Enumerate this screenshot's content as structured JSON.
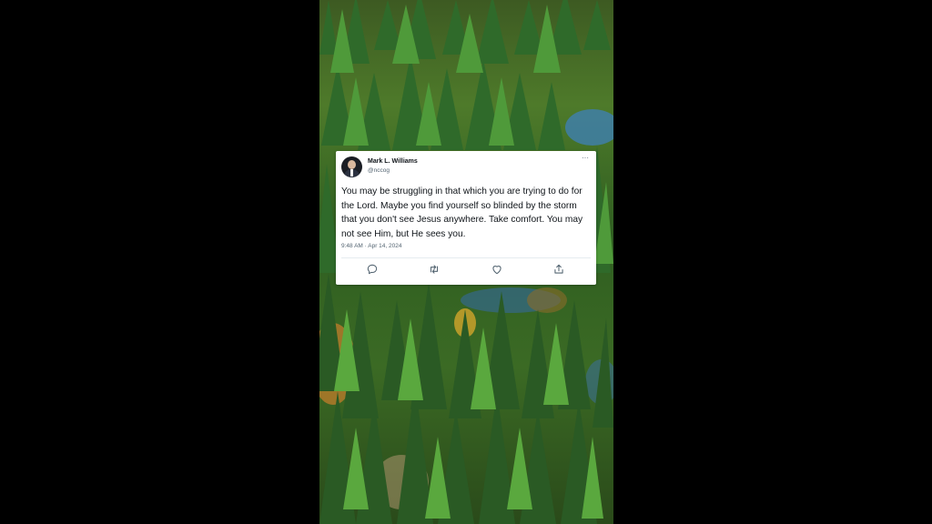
{
  "tweet": {
    "author_name": "Mark L. Williams",
    "author_handle": "@nccog",
    "more_glyph": "···",
    "text": "You may be struggling in that which you are trying to do for the Lord. Maybe you find yourself so blinded by the storm that you don't see Jesus anywhere. Take comfort. You may not see Him, but He sees you.",
    "timestamp": "9:48 AM · Apr 14, 2024",
    "actions": [
      "reply-icon",
      "retweet-icon",
      "like-icon",
      "share-icon"
    ]
  },
  "colors": {
    "page_background": "#000000",
    "card_background": "#ffffff",
    "primary_text": "#0f1419",
    "secondary_text": "#536471",
    "icon": "#536471"
  }
}
